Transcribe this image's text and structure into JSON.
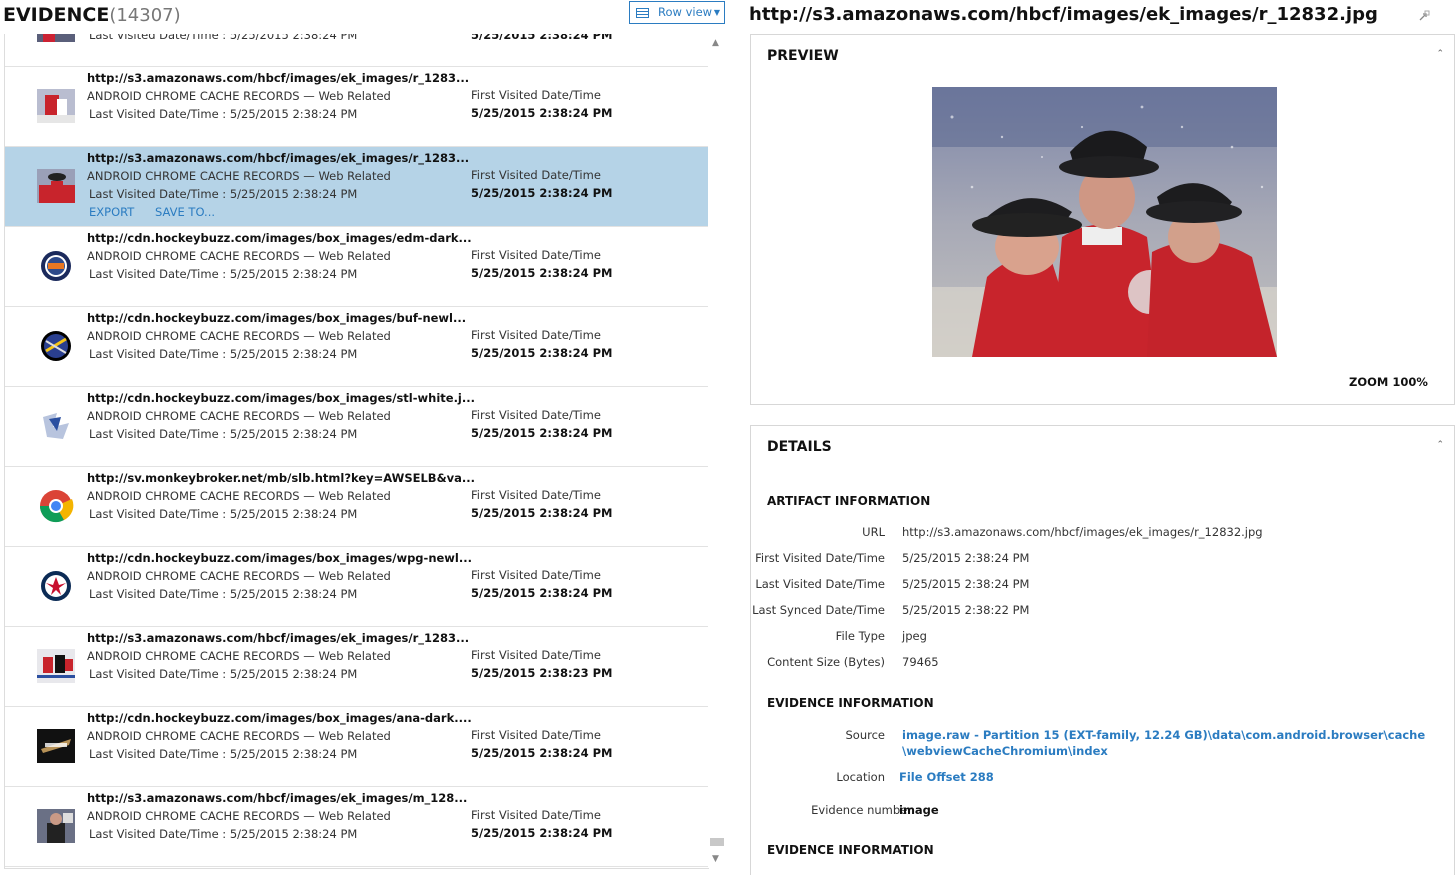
{
  "evidence": {
    "title": "EVIDENCE",
    "count": "(14307)",
    "view_button": "Row view"
  },
  "partial_row": {
    "last_text": "Last Visited Date/Time :  5/25/2015 2:38:24 PM",
    "first_value": "5/25/2015 2:38:24 PM"
  },
  "rows": [
    {
      "url": "http://s3.amazonaws.com/hbcf/images/ek_images/r_1283...",
      "source": "ANDROID CHROME CACHE RECORDS",
      "category": "Web Related",
      "last_label": "Last Visited Date/Time :",
      "last_value": "5/25/2015 2:38:24 PM",
      "first_label": "First Visited Date/Time",
      "first_value": "5/25/2015 2:38:24 PM",
      "thumb": "hockey-photo-icon",
      "selected": false
    },
    {
      "url": "http://s3.amazonaws.com/hbcf/images/ek_images/r_1283...",
      "source": "ANDROID CHROME CACHE RECORDS",
      "category": "Web Related",
      "last_label": "Last Visited Date/Time :",
      "last_value": "5/25/2015 2:38:24 PM",
      "first_label": "First Visited Date/Time",
      "first_value": "5/25/2015 2:38:24 PM",
      "thumb": "coaches-photo-icon",
      "selected": true,
      "actions": [
        "EXPORT",
        "SAVE TO..."
      ]
    },
    {
      "url": "http://cdn.hockeybuzz.com/images/box_images/edm-dark...",
      "source": "ANDROID CHROME CACHE RECORDS",
      "category": "Web Related",
      "last_label": "Last Visited Date/Time :",
      "last_value": "5/25/2015 2:38:24 PM",
      "first_label": "First Visited Date/Time",
      "first_value": "5/25/2015 2:38:24 PM",
      "thumb": "oilers-logo-icon",
      "selected": false
    },
    {
      "url": "http://cdn.hockeybuzz.com/images/box_images/buf-newl...",
      "source": "ANDROID CHROME CACHE RECORDS",
      "category": "Web Related",
      "last_label": "Last Visited Date/Time :",
      "last_value": "5/25/2015 2:38:24 PM",
      "first_label": "First Visited Date/Time",
      "first_value": "5/25/2015 2:38:24 PM",
      "thumb": "sabres-logo-icon",
      "selected": false
    },
    {
      "url": "http://cdn.hockeybuzz.com/images/box_images/stl-white.j...",
      "source": "ANDROID CHROME CACHE RECORDS",
      "category": "Web Related",
      "last_label": "Last Visited Date/Time :",
      "last_value": "5/25/2015 2:38:24 PM",
      "first_label": "First Visited Date/Time",
      "first_value": "5/25/2015 2:38:24 PM",
      "thumb": "blues-logo-icon",
      "selected": false
    },
    {
      "url": "http://sv.monkeybroker.net/mb/slb.html?key=AWSELB&va...",
      "source": "ANDROID CHROME CACHE RECORDS",
      "category": "Web Related",
      "last_label": "Last Visited Date/Time :",
      "last_value": "5/25/2015 2:38:24 PM",
      "first_label": "First Visited Date/Time",
      "first_value": "5/25/2015 2:38:24 PM",
      "thumb": "chrome-logo-icon",
      "selected": false
    },
    {
      "url": "http://cdn.hockeybuzz.com/images/box_images/wpg-newl...",
      "source": "ANDROID CHROME CACHE RECORDS",
      "category": "Web Related",
      "last_label": "Last Visited Date/Time :",
      "last_value": "5/25/2015 2:38:24 PM",
      "first_label": "First Visited Date/Time",
      "first_value": "5/25/2015 2:38:24 PM",
      "thumb": "jets-logo-icon",
      "selected": false
    },
    {
      "url": "http://s3.amazonaws.com/hbcf/images/ek_images/r_1283...",
      "source": "ANDROID CHROME CACHE RECORDS",
      "category": "Web Related",
      "last_label": "Last Visited Date/Time :",
      "last_value": "5/25/2015 2:38:24 PM",
      "first_label": "First Visited Date/Time",
      "first_value": "5/25/2015 2:38:23 PM",
      "thumb": "hockey-action-icon",
      "selected": false
    },
    {
      "url": "http://cdn.hockeybuzz.com/images/box_images/ana-dark....",
      "source": "ANDROID CHROME CACHE RECORDS",
      "category": "Web Related",
      "last_label": "Last Visited Date/Time :",
      "last_value": "5/25/2015 2:38:24 PM",
      "first_label": "First Visited Date/Time",
      "first_value": "5/25/2015 2:38:24 PM",
      "thumb": "ducks-logo-icon",
      "selected": false
    },
    {
      "url": "http://s3.amazonaws.com/hbcf/images/ek_images/m_128...",
      "source": "ANDROID CHROME CACHE RECORDS",
      "category": "Web Related",
      "last_label": "Last Visited Date/Time :",
      "last_value": "5/25/2015 2:38:24 PM",
      "first_label": "First Visited Date/Time",
      "first_value": "5/25/2015 2:38:24 PM",
      "thumb": "interview-photo-icon",
      "selected": false
    }
  ],
  "detail": {
    "title": "http://s3.amazonaws.com/hbcf/images/ek_images/r_12832.jpg",
    "preview": {
      "heading": "PREVIEW",
      "zoom": "ZOOM 100%"
    },
    "details": {
      "heading": "DETAILS",
      "artifact_heading": "ARTIFACT INFORMATION",
      "artifact": [
        {
          "label": "URL",
          "value": "http://s3.amazonaws.com/hbcf/images/ek_images/r_12832.jpg"
        },
        {
          "label": "First Visited Date/Time",
          "value": "5/25/2015 2:38:24 PM"
        },
        {
          "label": "Last Visited Date/Time",
          "value": "5/25/2015 2:38:24 PM"
        },
        {
          "label": "Last Synced Date/Time",
          "value": "5/25/2015 2:38:22 PM"
        },
        {
          "label": "File Type",
          "value": "jpeg"
        },
        {
          "label": "Content Size (Bytes)",
          "value": "79465"
        }
      ],
      "evidence_heading": "EVIDENCE INFORMATION",
      "evidence": {
        "source_label": "Source",
        "source_line1": "image.raw - Partition 15 (EXT-family, 12.24 GB)\\data\\com.android.browser\\cache",
        "source_line2": "\\webviewCacheChromium\\index",
        "location_label": "Location",
        "location_value": "File Offset 288",
        "number_label": "Evidence number",
        "number_value": "image"
      },
      "evidence_heading_2": "EVIDENCE INFORMATION"
    }
  },
  "colors": {
    "accent": "#2b7cc1",
    "selected_row": "#b5d3e7"
  }
}
